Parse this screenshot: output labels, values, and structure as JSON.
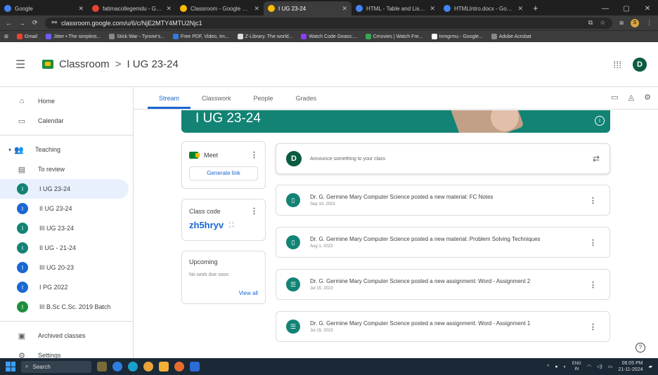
{
  "browser": {
    "tabs": [
      {
        "title": "Google",
        "color": "#4285f4",
        "active": false
      },
      {
        "title": "fatimacollegemdu - Googl",
        "color": "#e84335",
        "active": false
      },
      {
        "title": "Classroom - Google Drive",
        "color": "#fbbc04",
        "active": false
      },
      {
        "title": "I UG 23-24",
        "color": "#fbbc04",
        "active": true
      },
      {
        "title": "HTML - Table and List.doc",
        "color": "#4285f4",
        "active": false
      },
      {
        "title": "HTMLIntro.docx - Google",
        "color": "#4285f4",
        "active": false
      }
    ],
    "new_tab": "+",
    "url": "classroom.google.com/u/6/c/NjE2MTY4MTU2Njc1",
    "bookmarks": [
      {
        "label": "Gmail",
        "color": "#ea4335"
      },
      {
        "label": "Jitter • The simplest...",
        "color": "#6b5cff"
      },
      {
        "label": "Stick War - Tyrone's...",
        "color": "#888888"
      },
      {
        "label": "Free PDF, Video, Im...",
        "color": "#2f7de1"
      },
      {
        "label": "Z-Library. The world...",
        "color": "#dddddd"
      },
      {
        "label": "Watch Code Geass:...",
        "color": "#8a3cff"
      },
      {
        "label": "Cmovies | Watch Fre...",
        "color": "#34a853"
      },
      {
        "label": "tnmgrmu - Google...",
        "color": "#ffffff"
      },
      {
        "label": "Adobe Acrobat",
        "color": "#888888"
      }
    ],
    "profile_initial": "S"
  },
  "header": {
    "app_name": "Classroom",
    "separator": ">",
    "class_name": "I UG 23-24",
    "avatar_initial": "D"
  },
  "sidebar": {
    "top": [
      {
        "label": "Home",
        "icon": "⌂"
      },
      {
        "label": "Calendar",
        "icon": "▭"
      }
    ],
    "teaching": {
      "label": "Teaching",
      "icon": "👥"
    },
    "review": {
      "label": "To review",
      "icon": "▤"
    },
    "classes": [
      {
        "label": "I UG 23-24",
        "initial": "I",
        "color": "#128375",
        "active": true
      },
      {
        "label": "II UG 23-24",
        "initial": "I",
        "color": "#1967d2",
        "active": false
      },
      {
        "label": "III UG 23-24",
        "initial": "I",
        "color": "#128375",
        "active": false
      },
      {
        "label": "II UG - 21-24",
        "initial": "I",
        "color": "#128375",
        "active": false
      },
      {
        "label": "III UG 20-23",
        "initial": "I",
        "color": "#1967d2",
        "active": false
      },
      {
        "label": "I PG 2022",
        "initial": "I",
        "color": "#1967d2",
        "active": false
      },
      {
        "label": "III B.Sc C.Sc. 2019 Batch",
        "initial": "I",
        "color": "#1e8e3e",
        "active": false
      }
    ],
    "bottom": [
      {
        "label": "Archived classes",
        "icon": "▣"
      },
      {
        "label": "Settings",
        "icon": "⚙"
      }
    ]
  },
  "subtabs": [
    {
      "label": "Stream",
      "active": true
    },
    {
      "label": "Classwork",
      "active": false
    },
    {
      "label": "People",
      "active": false
    },
    {
      "label": "Grades",
      "active": false
    }
  ],
  "banner": {
    "title": "I UG 23-24"
  },
  "meet": {
    "label": "Meet",
    "button": "Generate link"
  },
  "class_code": {
    "label": "Class code",
    "value": "zh5hryv"
  },
  "upcoming": {
    "title": "Upcoming",
    "empty": "No work due soon",
    "link": "View all"
  },
  "announce": {
    "avatar_initial": "D",
    "placeholder": "Announce something to your class"
  },
  "posts": [
    {
      "title": "Dr. G. Germine Mary Computer Science posted a new material: FC Notes",
      "date": "Sep 10, 2023",
      "type": "material"
    },
    {
      "title": "Dr. G. Germine Mary Computer Science posted a new material: Problem Solving Techniques",
      "date": "Aug 1, 2023",
      "type": "material"
    },
    {
      "title": "Dr. G. Germine Mary Computer Science posted a new assignment: Word - Assignment 2",
      "date": "Jul 15, 2023",
      "type": "assignment"
    },
    {
      "title": "Dr. G. Germine Mary Computer Science posted a new assignment: Word - Assignment 1",
      "date": "Jul 15, 2023",
      "type": "assignment"
    }
  ],
  "taskbar": {
    "search": "Search",
    "lang_top": "ENG",
    "lang_bottom": "IN",
    "time": "06:05 PM",
    "date": "21-11-2024"
  }
}
